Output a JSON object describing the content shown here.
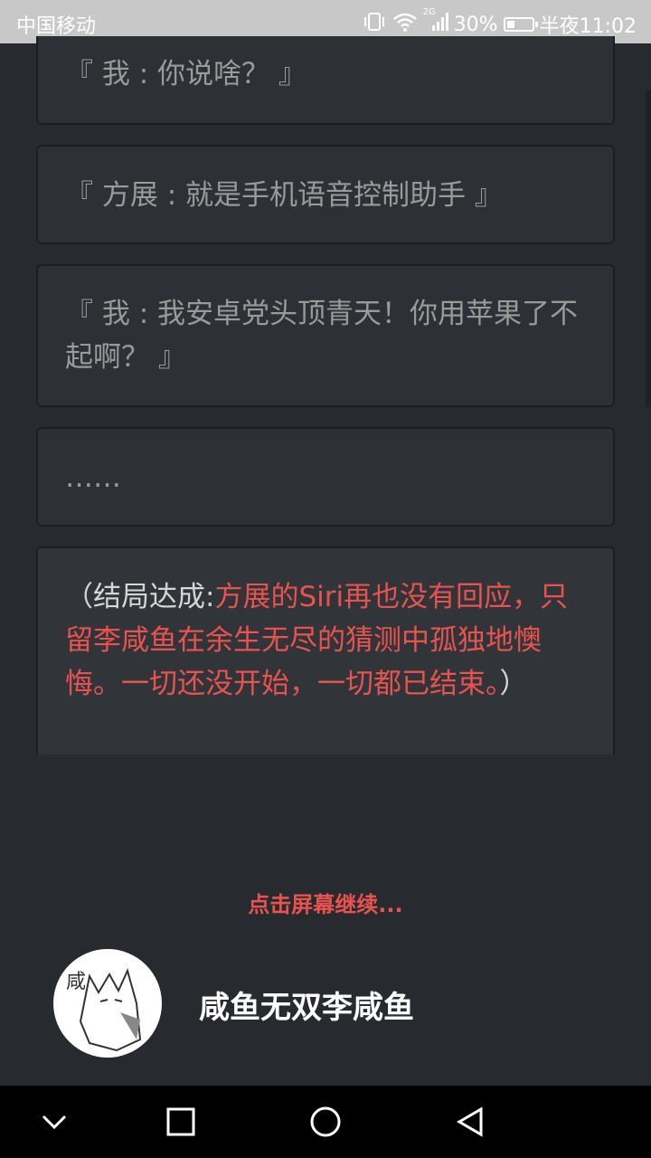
{
  "status_bar": {
    "carrier": "中国移动",
    "network": "2G",
    "battery_percent": "30%",
    "battery_level": 0.3,
    "time": "半夜11:02"
  },
  "messages": [
    {
      "text": "『 我 : 你说啥？ 』"
    },
    {
      "text": "『 方展 : 就是手机语音控制助手 』"
    },
    {
      "text": "『 我 : 我安卓党头顶青天！你用苹果了不起啊？ 』"
    },
    {
      "text": "……"
    }
  ],
  "ending": {
    "prefix": "（结局达成:",
    "red_text": "方展的Siri再也没有回应，只留李咸鱼在余生无尽的猜测中孤独地懊悔。一切还没开始，一切都已结束。",
    "suffix": "）"
  },
  "continue_prompt": "点击屏幕继续...",
  "author": {
    "avatar_char": "咸",
    "name": "咸鱼无双李咸鱼"
  },
  "nav": {
    "icons": [
      "chevron-down-icon",
      "square-icon",
      "circle-icon",
      "back-triangle-icon"
    ]
  },
  "colors": {
    "accent_red": "#e8534f",
    "background": "#272a2f",
    "card": "#2d3035"
  }
}
